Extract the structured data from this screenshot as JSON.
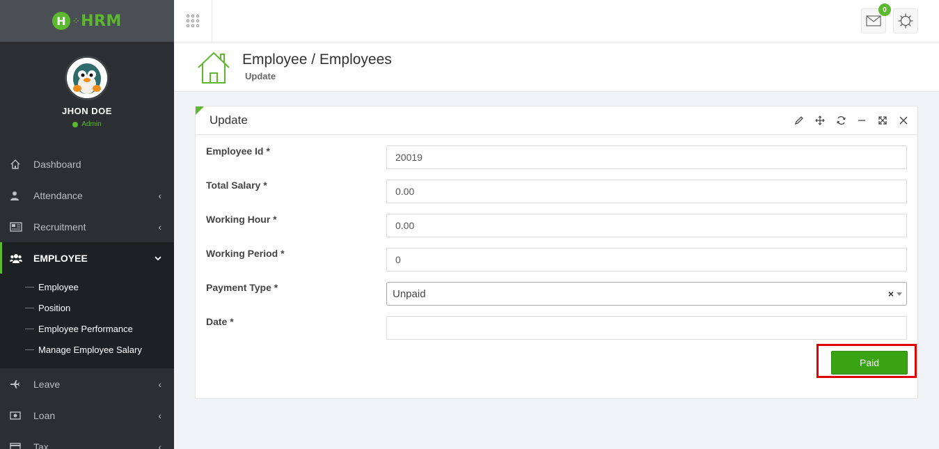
{
  "app": {
    "logo_text": "HRM",
    "accent": "#5cb82e"
  },
  "profile": {
    "name": "JHON DOE",
    "role": "Admin"
  },
  "sidebar": {
    "items": [
      {
        "label": "Dashboard",
        "icon": "home-icon"
      },
      {
        "label": "Attendance",
        "icon": "user-icon"
      },
      {
        "label": "Recruitment",
        "icon": "newspaper-icon"
      },
      {
        "label": "EMPLOYEE",
        "icon": "users-icon"
      },
      {
        "label": "Leave",
        "icon": "plane-icon"
      },
      {
        "label": "Loan",
        "icon": "money-icon"
      },
      {
        "label": "Tax",
        "icon": "card-icon"
      }
    ],
    "employee_submenu": [
      "Employee",
      "Position",
      "Employee Performance",
      "Manage Employee Salary"
    ]
  },
  "topbar": {
    "message_count": "0"
  },
  "page_header": {
    "title": "Employee / Employees",
    "subtitle": "Update"
  },
  "panel": {
    "title": "Update",
    "fields": {
      "employee_id": {
        "label": "Employee Id *",
        "value": "20019"
      },
      "total_salary": {
        "label": "Total Salary *",
        "value": "0.00"
      },
      "working_hour": {
        "label": "Working Hour *",
        "value": "0.00"
      },
      "working_period": {
        "label": "Working Period *",
        "value": "0"
      },
      "payment_type": {
        "label": "Payment Type *",
        "value": "Unpaid",
        "clear": "×"
      },
      "date": {
        "label": "Date *",
        "value": ""
      }
    },
    "submit_label": "Paid"
  }
}
